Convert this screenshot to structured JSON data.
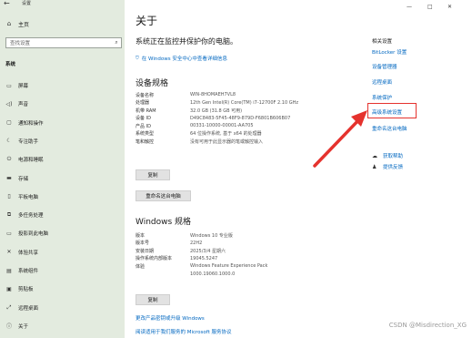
{
  "window": {
    "title": "设置",
    "back_icon": "←",
    "minimize_icon": "—",
    "maximize_icon": "□",
    "close_icon": "✕"
  },
  "sidebar": {
    "home_label": "主页",
    "search_placeholder": "查找设置",
    "section": "系统",
    "items": [
      {
        "label": "屏幕",
        "icon": "▭"
      },
      {
        "label": "声音",
        "icon": "◁)"
      },
      {
        "label": "通知和操作",
        "icon": "▢"
      },
      {
        "label": "专注助手",
        "icon": "☾"
      },
      {
        "label": "电源和睡眠",
        "icon": "⏻"
      },
      {
        "label": "存储",
        "icon": "▬"
      },
      {
        "label": "平板电脑",
        "icon": "▯"
      },
      {
        "label": "多任务处理",
        "icon": "⧉"
      },
      {
        "label": "投影到此电脑",
        "icon": "▭"
      },
      {
        "label": "体验共享",
        "icon": "✕"
      },
      {
        "label": "系统组件",
        "icon": "▤"
      },
      {
        "label": "剪贴板",
        "icon": "▣"
      },
      {
        "label": "远程桌面",
        "icon": "⤢"
      },
      {
        "label": "关于",
        "icon": "ⓘ"
      }
    ]
  },
  "main": {
    "title": "关于",
    "protect_heading": "系统正在监控并保护你的电脑。",
    "security_link": "在 Windows 安全中心中查看详细信息",
    "device_heading": "设备规格",
    "device_specs": [
      {
        "k": "设备名称",
        "v": "WIN-8HOMAEH7VL8"
      },
      {
        "k": "处理器",
        "v": "12th Gen Intel(R) Core(TM) i7-12700F   2.10 GHz"
      },
      {
        "k": "机带 RAM",
        "v": "32.0 GB (31.8 GB 可用)"
      },
      {
        "k": "设备 ID",
        "v": "D49C8483-5F45-48F9-879D-F6801B606B07"
      },
      {
        "k": "产品 ID",
        "v": "00331-10000-00001-AA705"
      },
      {
        "k": "系统类型",
        "v": "64 位操作系统, 基于 x64 的处理器"
      },
      {
        "k": "笔和触控",
        "v": "没有可用于此显示器的笔或触控输入"
      }
    ],
    "copy_button": "复制",
    "rename_button": "重命名这台电脑",
    "windows_heading": "Windows 规格",
    "windows_specs": [
      {
        "k": "版本",
        "v": "Windows 10 专业版"
      },
      {
        "k": "版本号",
        "v": "22H2"
      },
      {
        "k": "安装日期",
        "v": "2025/3/4 星期六"
      },
      {
        "k": "操作系统内部版本",
        "v": "19045.5247"
      },
      {
        "k": "体验",
        "v": "Windows Feature Experience Pack"
      },
      {
        "k": "",
        "v": "1000.19060.1000.0"
      }
    ],
    "copy_button2": "复制",
    "link_product_key": "更改产品密钥或升级 Windows",
    "link_service": "阅读适用于我们服务的 Microsoft 服务协议"
  },
  "related": {
    "heading": "相关设置",
    "links": [
      "BitLocker 设置",
      "设备管理器",
      "远程桌面",
      "系统保护",
      "高级系统设置",
      "重命名这台电脑"
    ],
    "help_label": "获取帮助",
    "feedback_label": "提供反馈"
  },
  "watermark": "CSDN @Misdirection_XG",
  "colors": {
    "accent": "#0067c0",
    "sidebar_bg": "#e3ebdf",
    "annotation_red": "#e5322d"
  }
}
